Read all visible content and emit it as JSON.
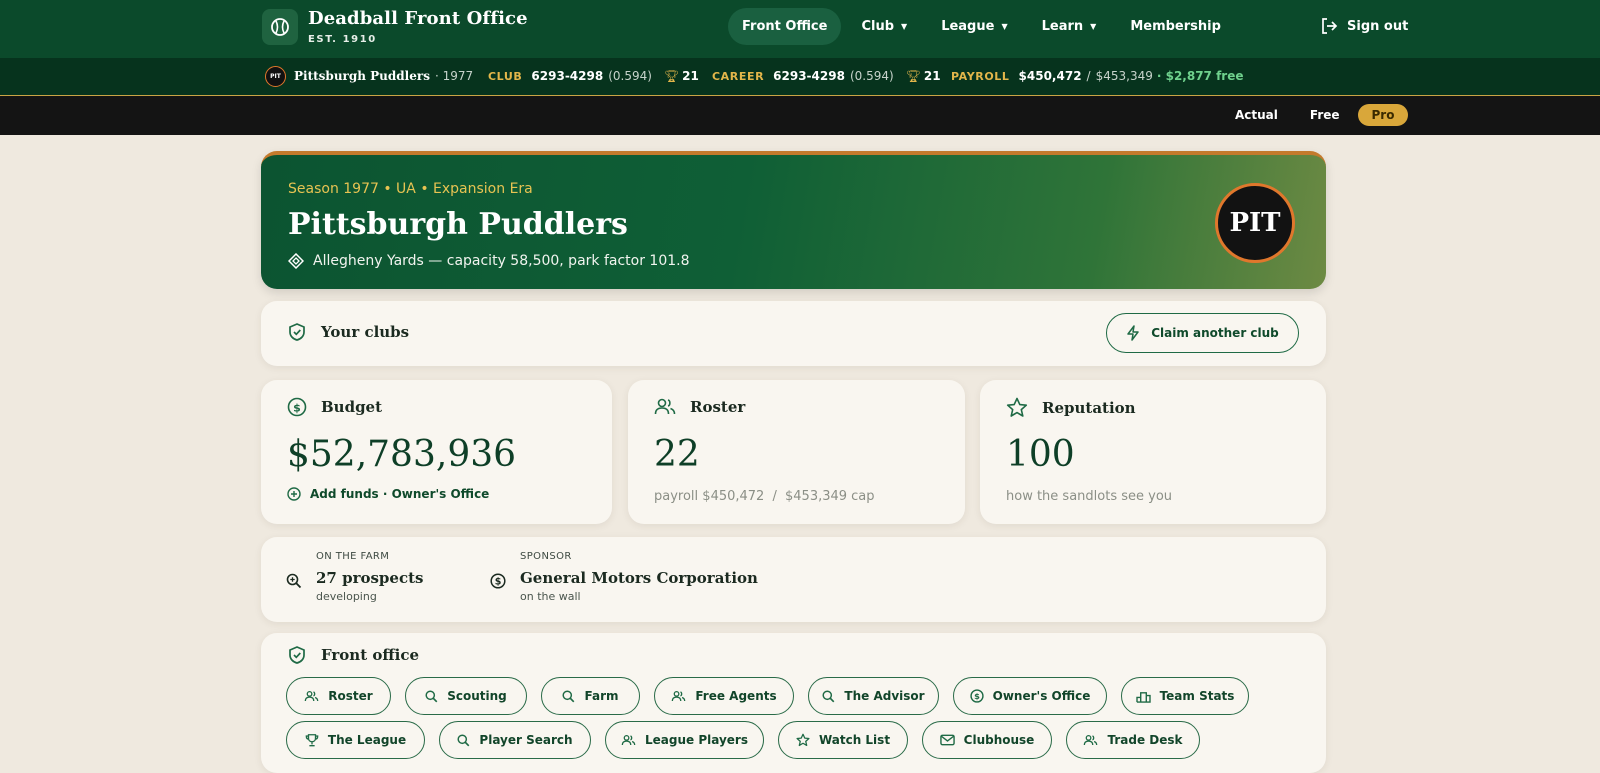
{
  "nav": {
    "brand_title": "Deadball Front Office",
    "brand_sub": "EST. 1910",
    "links": [
      {
        "label": "Front Office",
        "active": true,
        "dropdown": false
      },
      {
        "label": "Club",
        "active": false,
        "dropdown": true
      },
      {
        "label": "League",
        "active": false,
        "dropdown": true
      },
      {
        "label": "Learn",
        "active": false,
        "dropdown": true
      },
      {
        "label": "Membership",
        "active": false,
        "dropdown": false
      }
    ],
    "signout": "Sign out"
  },
  "statsbar": {
    "chip": "PIT",
    "team": "Pittsburgh Puddlers",
    "year": "· 1977",
    "club_key": "CLUB",
    "club_record": "6293-4298",
    "club_pct": "(0.594)",
    "club_titles": "21",
    "career_key": "CAREER",
    "career_record": "6293-4298",
    "career_pct": "(0.594)",
    "career_titles": "21",
    "payroll_key": "PAYROLL",
    "payroll": "$450,472",
    "payroll_sep": "/",
    "payroll_cap": "$453,349",
    "payroll_free": "· $2,877 free"
  },
  "modes": [
    "Actual",
    "Free",
    "Pro"
  ],
  "hero": {
    "season": "Season 1977 • UA • Expansion Era",
    "title": "Pittsburgh Puddlers",
    "park": "Allegheny Yards — capacity 58,500, park factor 101.8",
    "logo": "PIT"
  },
  "clubs": {
    "title": "Your clubs",
    "claim": "Claim another club"
  },
  "budget": {
    "title": "Budget",
    "value": "$52,783,936",
    "link": "Add funds · Owner's Office"
  },
  "roster": {
    "title": "Roster",
    "value": "22",
    "sub_prefix": "payroll",
    "payroll": "$450,472",
    "sep": "/",
    "cap": "$453,349 cap"
  },
  "reputation": {
    "title": "Reputation",
    "value": "100",
    "sub": "how the sandlots see you"
  },
  "farm": {
    "kicker": "ON THE FARM",
    "main": "27 prospects",
    "sub": "developing"
  },
  "sponsor": {
    "kicker": "SPONSOR",
    "main": "General Motors Corporation",
    "sub": "on the wall"
  },
  "office": {
    "title": "Front office",
    "row1": [
      "Roster",
      "Scouting",
      "Farm",
      "Free Agents",
      "The Advisor",
      "Owner's Office",
      "Team Stats"
    ],
    "row2": [
      "The League",
      "Player Search",
      "League Players",
      "Watch List",
      "Clubhouse",
      "Trade Desk"
    ]
  },
  "colors": {
    "nav_green": "#0b4a2b",
    "stats_green": "#06331d",
    "gold": "#d9a73a",
    "accent_orange": "#e0772c",
    "free_green": "#6fd18d"
  }
}
